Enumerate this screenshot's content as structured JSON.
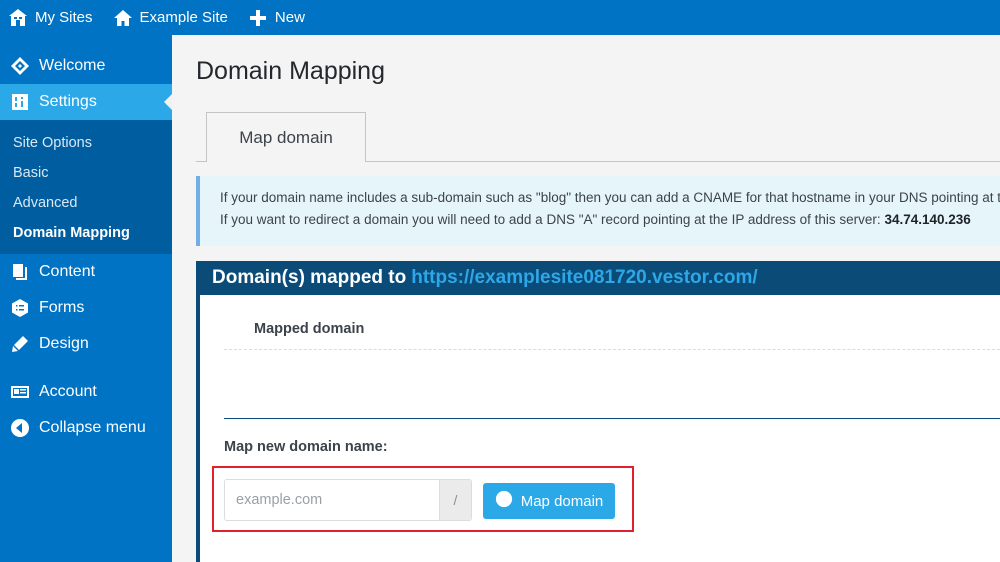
{
  "topbar": {
    "items": [
      {
        "label": "My Sites",
        "icon": "my-sites-icon"
      },
      {
        "label": "Example Site",
        "icon": "home-icon"
      },
      {
        "label": "New",
        "icon": "plus-icon"
      }
    ]
  },
  "sidebar": {
    "items": [
      {
        "label": "Welcome",
        "icon": "welcome-icon"
      },
      {
        "label": "Settings",
        "icon": "settings-icon",
        "active": true
      },
      {
        "label": "Content",
        "icon": "content-icon"
      },
      {
        "label": "Forms",
        "icon": "forms-icon"
      },
      {
        "label": "Design",
        "icon": "design-icon"
      },
      {
        "label": "Account",
        "icon": "account-icon"
      },
      {
        "label": "Collapse menu",
        "icon": "collapse-icon"
      }
    ],
    "submenu": [
      "Site Options",
      "Basic",
      "Advanced",
      "Domain Mapping"
    ],
    "current_submenu": "Domain Mapping"
  },
  "page": {
    "title": "Domain Mapping",
    "tab": "Map domain",
    "notice_line1": "If your domain name includes a sub-domain such as \"blog\" then you can add a CNAME for that hostname in your DNS pointing at t",
    "notice_line2": "If you want to redirect a domain you will need to add a DNS \"A\" record pointing at the IP address of this server: ",
    "server_ip": "34.74.140.236"
  },
  "panel": {
    "heading": "Domain(s) mapped to",
    "site_url": "https://examplesite081720.vestor.com/",
    "column_header": "Mapped domain",
    "new_label": "Map new domain name:",
    "input_placeholder": "example.com",
    "separator": "/",
    "button_label": "Map domain"
  },
  "colors": {
    "admin_bar": "#0073c4",
    "active_menu": "#2ba8e8",
    "panel_header": "#0a4b78",
    "highlight": "#e0202c"
  }
}
